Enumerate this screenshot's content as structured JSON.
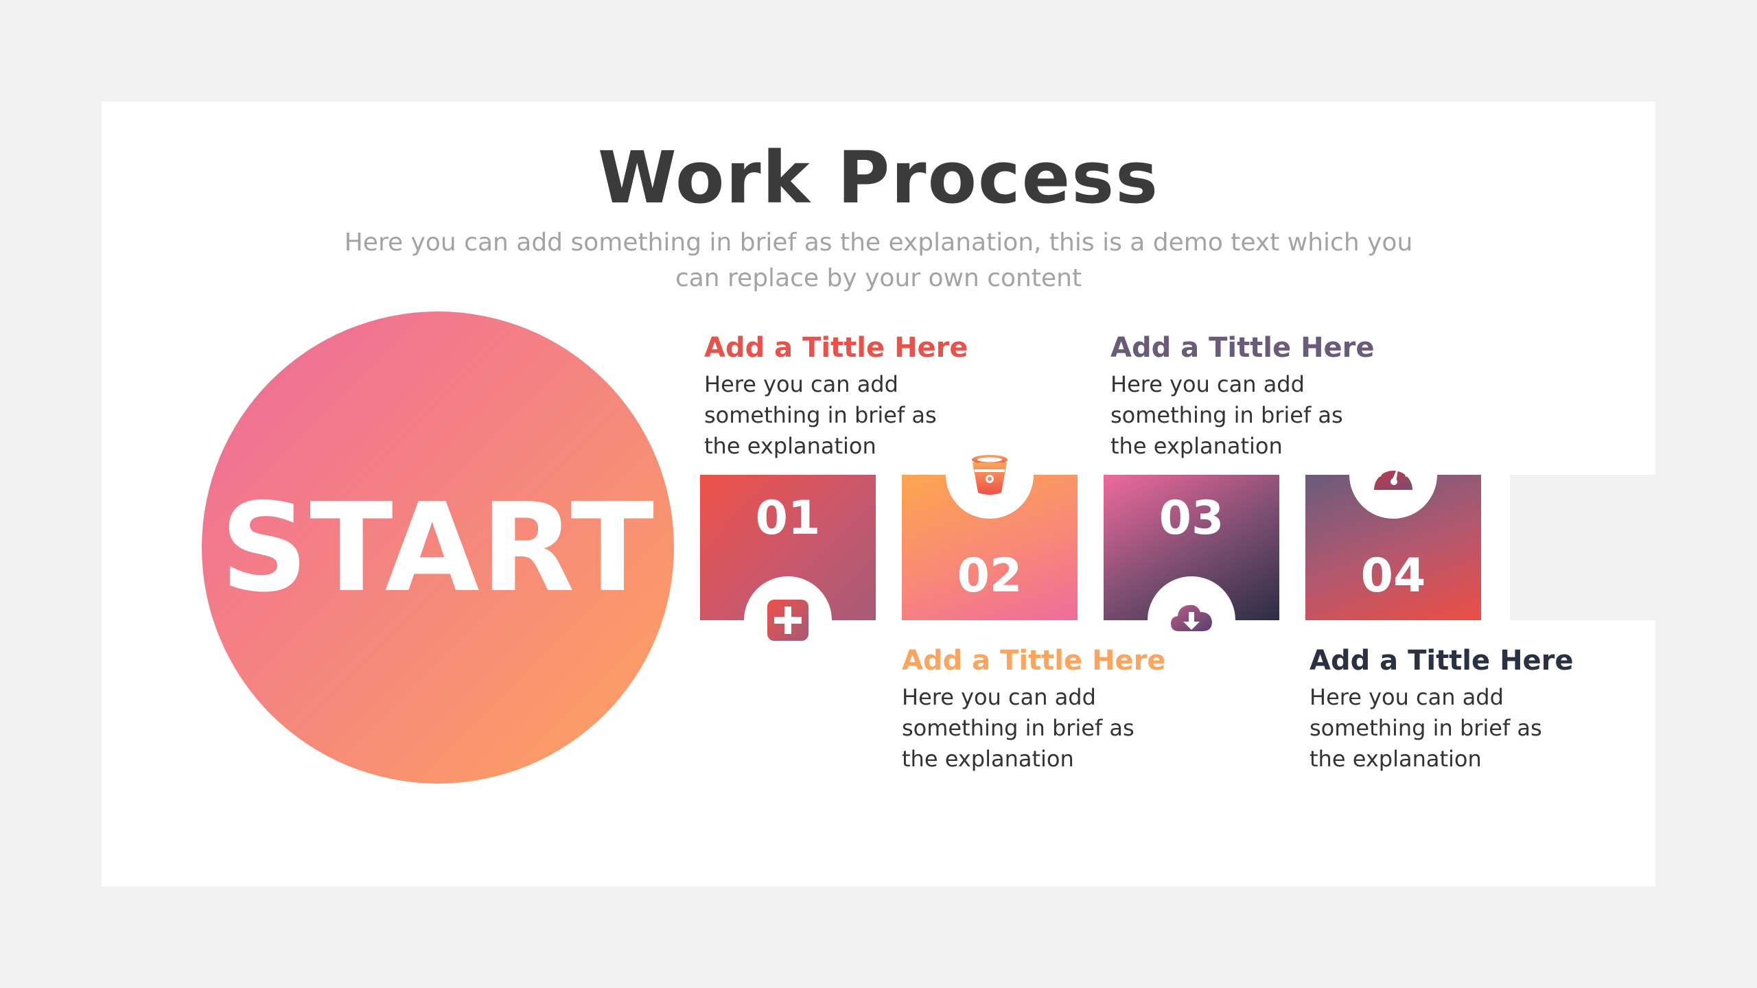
{
  "page": {
    "title": "Work Process",
    "subtitle": "Here you can add something in brief as the explanation, this is a demo text which you can replace by your own content"
  },
  "start": {
    "label": "START"
  },
  "steps": [
    {
      "number": "01",
      "title": "Add a Tittle Here",
      "text": "Here you can add something in brief as the explanation",
      "icon": "plus-square-icon",
      "color": "#e8524a"
    },
    {
      "number": "02",
      "title": "Add a Tittle Here",
      "text": "Here you can add something in brief as the explanation",
      "icon": "bucket-icon",
      "color": "#fda45e"
    },
    {
      "number": "03",
      "title": "Add a Tittle Here",
      "text": "Here you can add something in brief as the explanation",
      "icon": "cloud-download-icon",
      "color": "#6a5b7b"
    },
    {
      "number": "04",
      "title": "Add a Tittle Here",
      "text": "Here you can add something in brief as the explanation",
      "icon": "speedometer-icon",
      "color": "#2b3142"
    }
  ]
}
